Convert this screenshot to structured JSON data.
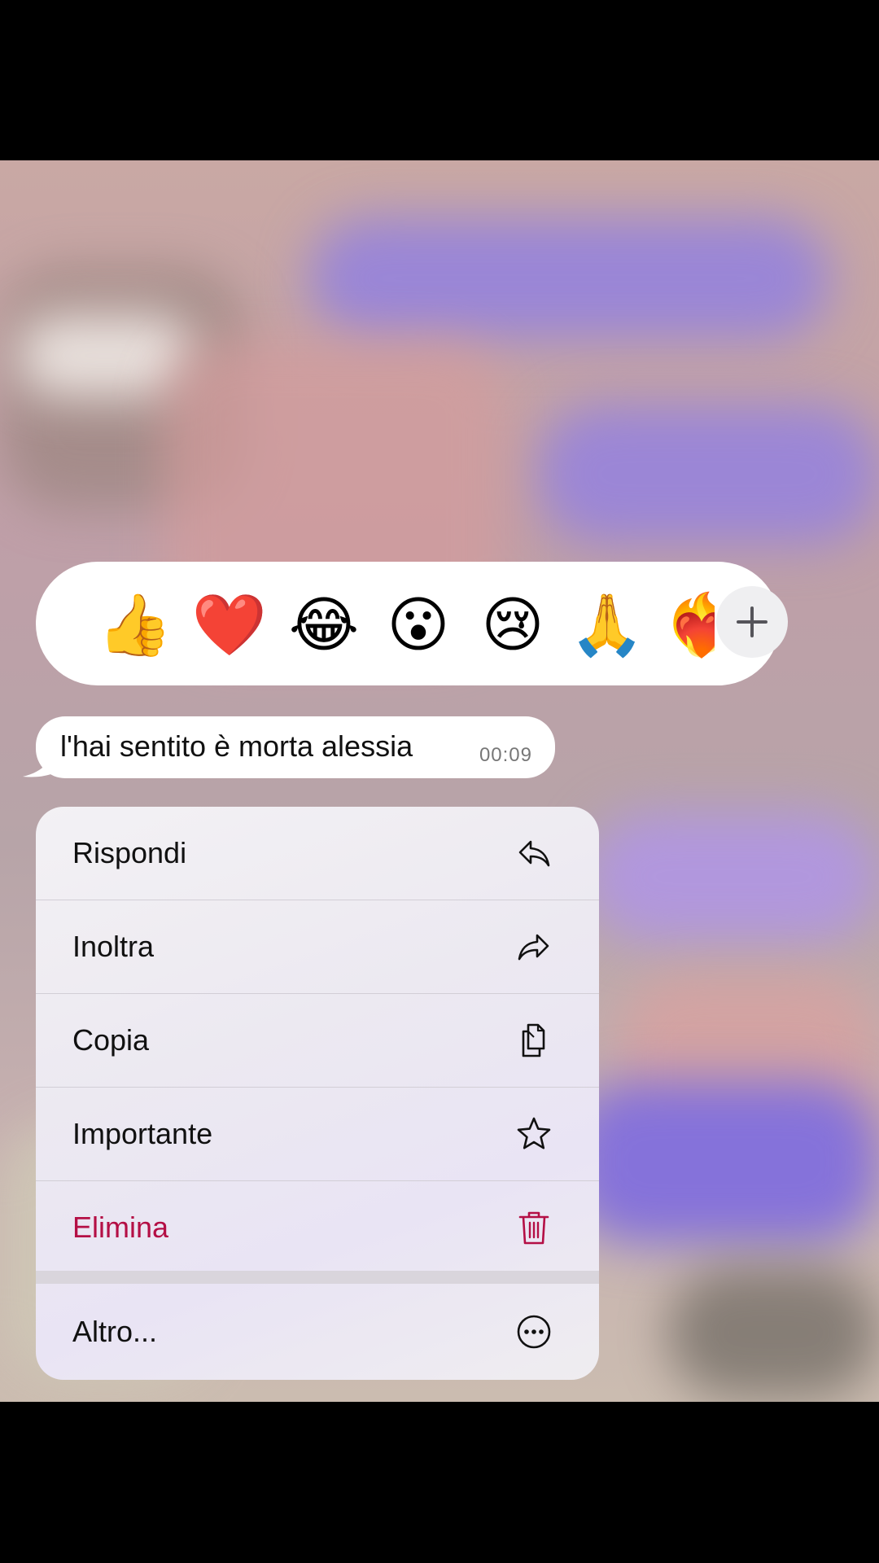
{
  "reactions": {
    "emojis": [
      "👍",
      "❤️",
      "😂",
      "😮",
      "😢",
      "🙏",
      "❤️‍🔥"
    ],
    "more_label": "+"
  },
  "message": {
    "text": "l'hai sentito è morta alessia",
    "time": "00:09"
  },
  "menu": {
    "items": [
      {
        "label": "Rispondi",
        "icon": "reply-icon"
      },
      {
        "label": "Inoltra",
        "icon": "forward-icon"
      },
      {
        "label": "Copia",
        "icon": "copy-icon"
      },
      {
        "label": "Importante",
        "icon": "star-icon"
      },
      {
        "label": "Elimina",
        "icon": "trash-icon",
        "color": "#b40f45"
      }
    ],
    "more": {
      "label": "Altro...",
      "icon": "ellipsis-circle-icon"
    }
  }
}
